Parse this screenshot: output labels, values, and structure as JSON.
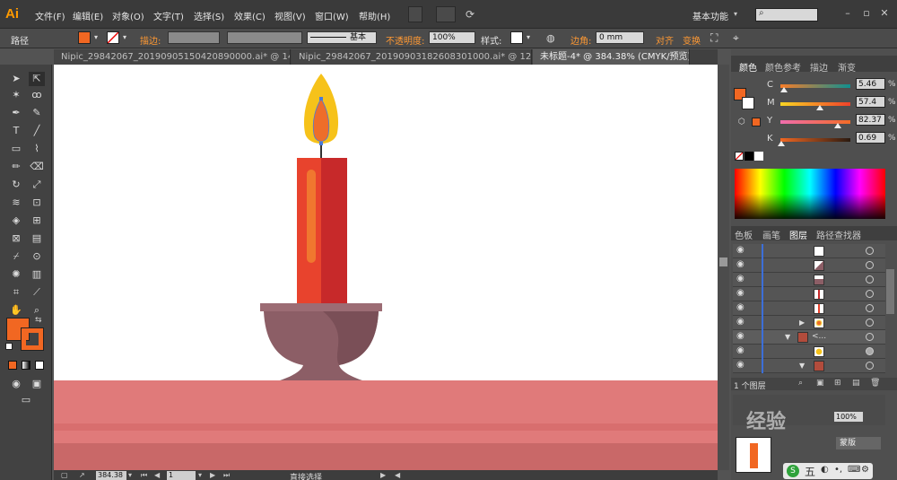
{
  "app": {
    "logo": "Ai"
  },
  "menu": [
    "文件(F)",
    "编辑(E)",
    "对象(O)",
    "文字(T)",
    "选择(S)",
    "效果(C)",
    "视图(V)",
    "窗口(W)",
    "帮助(H)"
  ],
  "workspace": "基本功能",
  "control_bar": {
    "selection_type": "路径",
    "stroke_label": "描边:",
    "stroke_style": "基本",
    "opacity_label": "不透明度:",
    "opacity_value": "100%",
    "style_label": "样式:",
    "corner_label": "边角:",
    "corner_value": "0 mm",
    "align_label": "对齐",
    "transform_label": "变换"
  },
  "tabs": [
    {
      "label": "Nipic_29842067_20190905150420890000.ai* @ 143...",
      "active": false
    },
    {
      "label": "Nipic_29842067_20190903182608301000.ai* @ 124...",
      "active": false
    },
    {
      "label": "未标题-4* @ 384.38% (CMYK/预览)",
      "active": true
    }
  ],
  "color_panel": {
    "tabs": [
      "颜色",
      "颜色参考",
      "描边",
      "渐变"
    ],
    "channels": [
      {
        "label": "C",
        "value": "5.46",
        "level": 0.05
      },
      {
        "label": "M",
        "value": "57.4",
        "level": 0.57
      },
      {
        "label": "Y",
        "value": "82.37",
        "level": 0.82
      },
      {
        "label": "K",
        "value": "0.69",
        "level": 0.01
      }
    ],
    "percent_sign": "%"
  },
  "layers_panel": {
    "tabs": [
      "色板",
      "画笔",
      "图层",
      "路径查找器"
    ],
    "row_count": 9,
    "footer": "1 个图层",
    "group_label": "<..."
  },
  "status_bar": {
    "zoom": "384.38",
    "page": "1",
    "tool": "直接选择"
  },
  "colors": {
    "fill": "#f16722",
    "candle_dark": "#c7292a",
    "candle_light": "#e8432d",
    "holder": "#8c5e66",
    "table": "#e07a7a",
    "flame_outer": "#f6c21a",
    "flame_inner": "#ee6d2a"
  },
  "watermark": "经验"
}
